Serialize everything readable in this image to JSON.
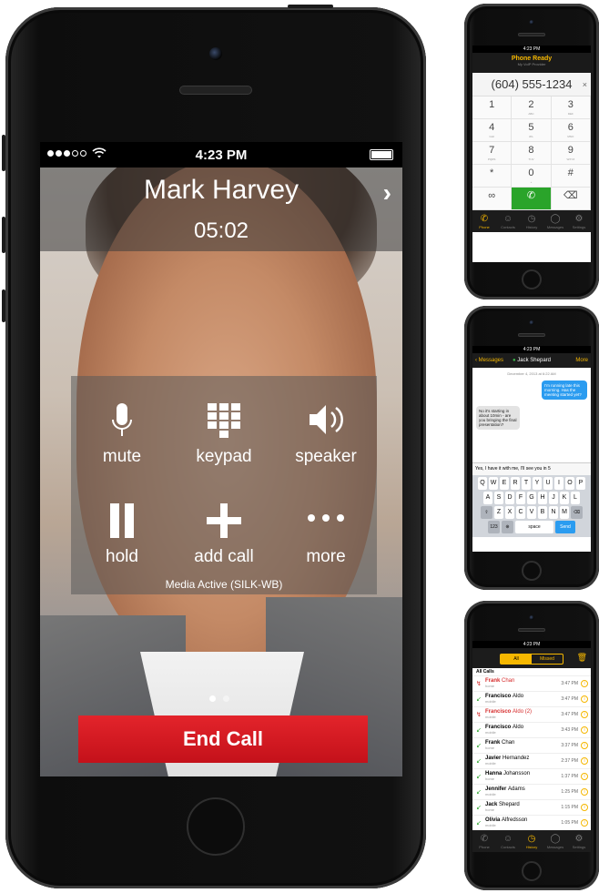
{
  "call": {
    "status_time": "4:23 PM",
    "caller_name": "Mark Harvey",
    "duration": "05:02",
    "controls": {
      "mute": "mute",
      "keypad": "keypad",
      "speaker": "speaker",
      "hold": "hold",
      "add_call": "add call",
      "more": "more"
    },
    "media_status": "Media Active (SILK-WB)",
    "end_call": "End Call"
  },
  "dialer": {
    "time": "4:23 PM",
    "title": "Phone Ready",
    "subtitle": "My VoIP Provider",
    "number": "(604) 555-1234",
    "keys": [
      {
        "d": "1",
        "s": ""
      },
      {
        "d": "2",
        "s": "ABC"
      },
      {
        "d": "3",
        "s": "DEF"
      },
      {
        "d": "4",
        "s": "GHI"
      },
      {
        "d": "5",
        "s": "JKL"
      },
      {
        "d": "6",
        "s": "MNO"
      },
      {
        "d": "7",
        "s": "PQRS"
      },
      {
        "d": "8",
        "s": "TUV"
      },
      {
        "d": "9",
        "s": "WXYZ"
      },
      {
        "d": "*",
        "s": ""
      },
      {
        "d": "0",
        "s": "+"
      },
      {
        "d": "#",
        "s": ""
      }
    ],
    "tabs": [
      "Phone",
      "Contacts",
      "History",
      "Messages",
      "Settings"
    ]
  },
  "messages": {
    "time": "4:23 PM",
    "back": "Messages",
    "contact": "Jack Shepard",
    "more": "More",
    "date": "December 4, 2013 at 6:22 AM",
    "outgoing": "I'm running late this morning. Has the meeting started yet?",
    "incoming": "No it's starting in about 10min - are you bringing the final presentation?",
    "draft": "Yes, I have it with me, I'll see you in 5",
    "kb_row1": [
      "Q",
      "W",
      "E",
      "R",
      "T",
      "Y",
      "U",
      "I",
      "O",
      "P"
    ],
    "kb_row2": [
      "A",
      "S",
      "D",
      "F",
      "G",
      "H",
      "J",
      "K",
      "L"
    ],
    "kb_row3": [
      "Z",
      "X",
      "C",
      "V",
      "B",
      "N",
      "M"
    ],
    "kb_num": "123",
    "kb_space": "space",
    "kb_send": "Send"
  },
  "recents": {
    "time": "4:23 PM",
    "seg_all": "All",
    "seg_missed": "Missed",
    "section": "All Calls",
    "rows": [
      {
        "first": "Frank",
        "last": "Chan",
        "type": "home",
        "time": "3:47 PM",
        "missed": true
      },
      {
        "first": "Francisco",
        "last": "Aldo",
        "type": "mobile",
        "time": "3:47 PM",
        "missed": false
      },
      {
        "first": "Francisco",
        "last": "Aldo (2)",
        "type": "mobile",
        "time": "3:47 PM",
        "missed": true
      },
      {
        "first": "Francisco",
        "last": "Aldo",
        "type": "mobile",
        "time": "3:43 PM",
        "missed": false
      },
      {
        "first": "Frank",
        "last": "Chan",
        "type": "home",
        "time": "3:37 PM",
        "missed": false
      },
      {
        "first": "Javier",
        "last": "Hernandez",
        "type": "mobile",
        "time": "2:37 PM",
        "missed": false
      },
      {
        "first": "Hanna",
        "last": "Johansson",
        "type": "home",
        "time": "1:37 PM",
        "missed": false
      },
      {
        "first": "Jennifer",
        "last": "Adams",
        "type": "mobile",
        "time": "1:25 PM",
        "missed": false
      },
      {
        "first": "Jack",
        "last": "Shepard",
        "type": "home",
        "time": "1:15 PM",
        "missed": false
      },
      {
        "first": "Olivia",
        "last": "Alfredsson",
        "type": "mobile",
        "time": "1:05 PM",
        "missed": false
      }
    ],
    "tabs": [
      "Phone",
      "Contacts",
      "History",
      "Messages",
      "Settings"
    ]
  },
  "colors": {
    "end_call": "#d31a22",
    "accent": "#f5b700",
    "call_green": "#2aa42a",
    "message_blue": "#2b9cf0"
  }
}
